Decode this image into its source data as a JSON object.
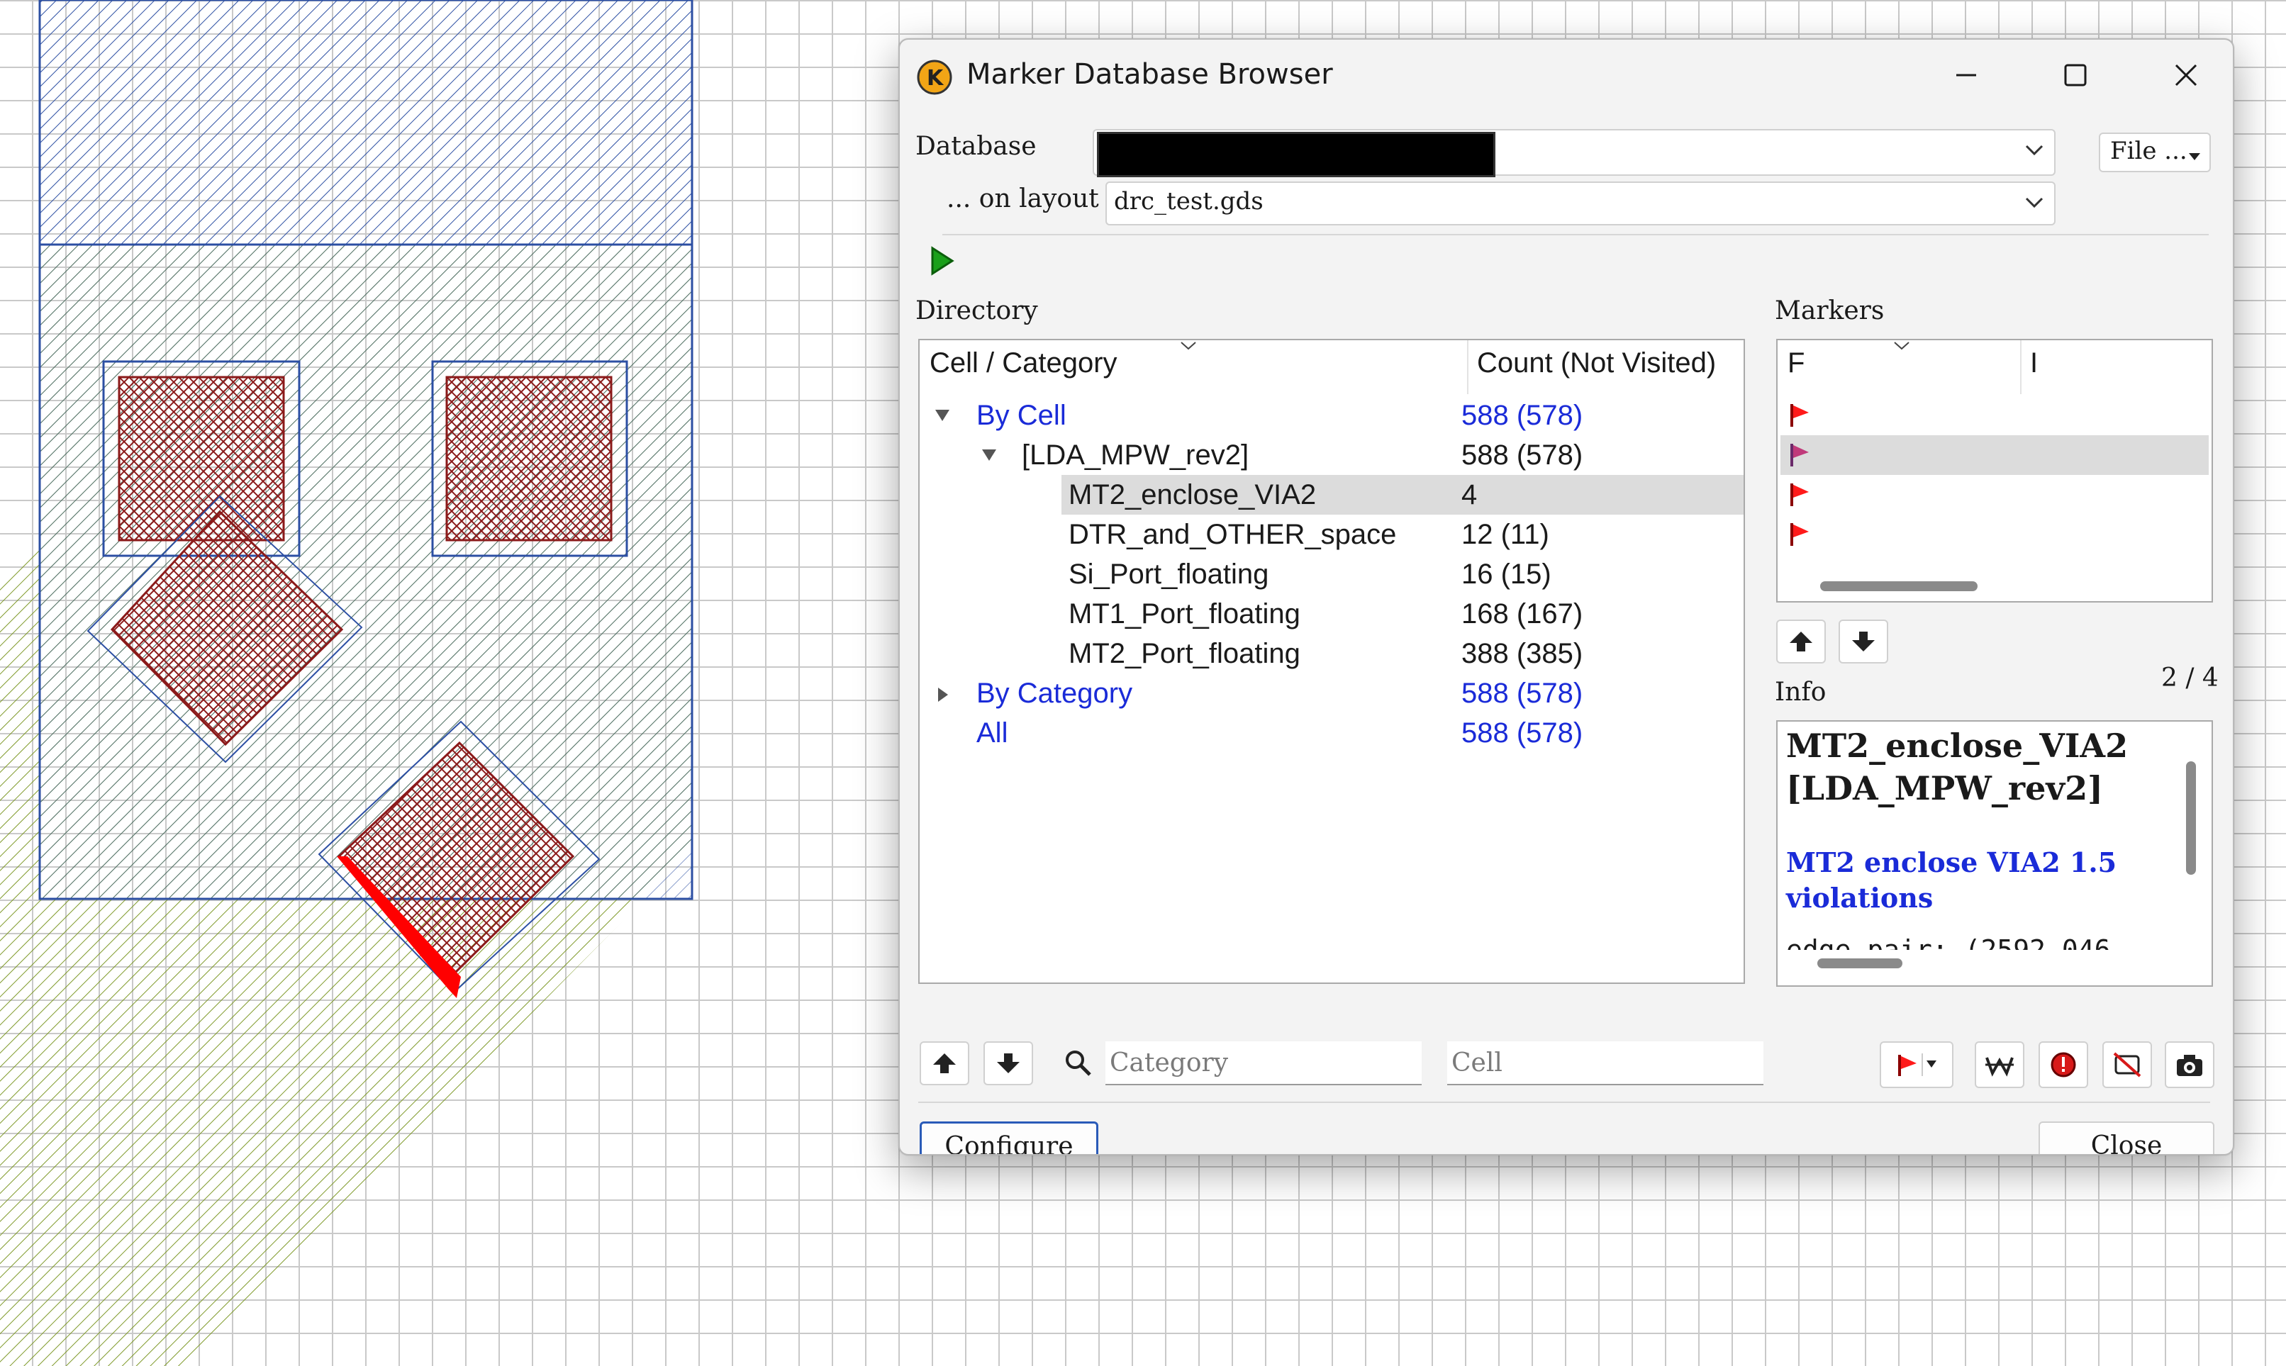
{
  "window": {
    "title": "Marker Database Browser"
  },
  "database": {
    "label": "Database",
    "value": "",
    "file_button": "File ..."
  },
  "layout": {
    "label": "... on layout",
    "value": "drc_test.gds"
  },
  "directory": {
    "label": "Directory",
    "col_name": "Cell / Category",
    "col_count": "Count (Not Visited)",
    "rows": [
      {
        "name": "By Cell",
        "count": "588 (578)"
      },
      {
        "name": "[LDA_MPW_rev2]",
        "count": "588 (578)"
      },
      {
        "name": "MT2_enclose_VIA2",
        "count": "4"
      },
      {
        "name": "DTR_and_OTHER_space",
        "count": "12 (11)"
      },
      {
        "name": "Si_Port_floating",
        "count": "16 (15)"
      },
      {
        "name": "MT1_Port_floating",
        "count": "168 (167)"
      },
      {
        "name": "MT2_Port_floating",
        "count": "388 (385)"
      },
      {
        "name": "By Category",
        "count": "588 (578)"
      },
      {
        "name": "All",
        "count": "588 (578)"
      }
    ]
  },
  "markers": {
    "label": "Markers",
    "col_f": "F",
    "col_i": "I",
    "counter": "2 / 4"
  },
  "info": {
    "label": "Info",
    "title_line1": "MT2_enclose_VIA2",
    "title_line2": "[LDA_MPW_rev2]",
    "description": "MT2 enclose VIA2 1.5 violations",
    "detail_cut": "edge_pair: (2592.046"
  },
  "filters": {
    "category_placeholder": "Category",
    "cell_placeholder": "Cell"
  },
  "buttons": {
    "configure": "Configure",
    "close": "Close"
  },
  "colors": {
    "link_blue": "#1a2bd8",
    "marker_red": "#ff0000",
    "run_green": "#1aa01a"
  },
  "icons": [
    "app-logo-icon",
    "minimize-icon",
    "maximize-icon",
    "close-icon",
    "chevron-down-icon",
    "run-icon",
    "arrow-up-icon",
    "arrow-down-icon",
    "search-icon",
    "flag-icon",
    "waive-icon",
    "important-icon",
    "hide-icon",
    "snapshot-icon"
  ]
}
